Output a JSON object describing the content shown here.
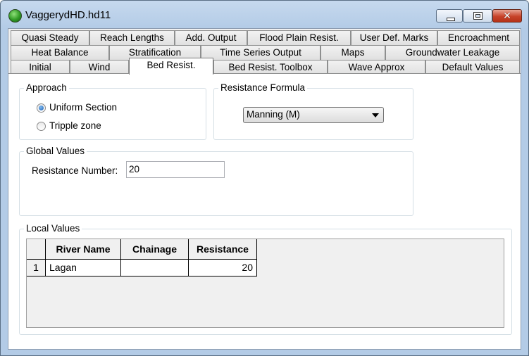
{
  "window": {
    "title": "VaggerydHD.hd11",
    "icon": "app-globe-icon"
  },
  "tabs": {
    "row1": [
      "Quasi Steady",
      "Reach Lengths",
      "Add. Output",
      "Flood Plain Resist.",
      "User Def. Marks",
      "Encroachment"
    ],
    "row2": [
      "Heat Balance",
      "Stratification",
      "Time Series Output",
      "Maps",
      "Groundwater Leakage"
    ],
    "row3": [
      "Initial",
      "Wind",
      "Bed Resist.",
      "Bed Resist. Toolbox",
      "Wave Approx",
      "Default Values"
    ],
    "active": "Bed Resist."
  },
  "approach": {
    "title": "Approach",
    "options": [
      "Uniform Section",
      "Tripple zone"
    ],
    "selected": "Uniform Section"
  },
  "formula": {
    "title": "Resistance Formula",
    "value": "Manning (M)"
  },
  "global_values": {
    "title": "Global Values",
    "resistance_label": "Resistance Number:",
    "resistance_value": "20"
  },
  "local_values": {
    "title": "Local Values",
    "columns": [
      "River Name",
      "Chainage",
      "Resistance"
    ],
    "rows": [
      {
        "index": "1",
        "river_name": "Lagan",
        "chainage": "",
        "resistance": "20"
      }
    ]
  }
}
